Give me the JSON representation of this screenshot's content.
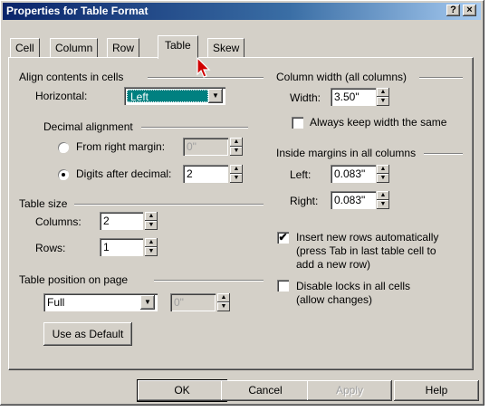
{
  "window": {
    "title": "Properties for Table Format",
    "help_btn": "?",
    "close_btn": "×"
  },
  "tabs": [
    {
      "label": "Cell"
    },
    {
      "label": "Column"
    },
    {
      "label": "Row"
    },
    {
      "label": "Table",
      "active": true
    },
    {
      "label": "Skew"
    }
  ],
  "align": {
    "group_label": "Align contents in cells",
    "horizontal_label": "Horizontal:",
    "horizontal_value": "Left",
    "decimal_group_label": "Decimal alignment",
    "from_right_label": "From right margin:",
    "from_right_value": "0\"",
    "digits_label": "Digits after decimal:",
    "digits_value": "2"
  },
  "table_size": {
    "group_label": "Table size",
    "columns_label": "Columns:",
    "columns_value": "2",
    "rows_label": "Rows:",
    "rows_value": "1"
  },
  "table_position": {
    "group_label": "Table position on page",
    "position_value": "Full",
    "offset_value": "0\""
  },
  "use_default_btn": "Use as Default",
  "column_width": {
    "group_label": "Column width (all columns)",
    "width_label": "Width:",
    "width_value": "3.50\"",
    "keep_same_label": "Always keep width the same"
  },
  "inside_margins": {
    "group_label": "Inside margins in all columns",
    "left_label": "Left:",
    "left_value": "0.083\"",
    "right_label": "Right:",
    "right_value": "0.083\""
  },
  "options": {
    "insert_rows_line1": "Insert new rows automatically",
    "insert_rows_line2": "(press Tab in last table cell to",
    "insert_rows_line3": "add a new row)",
    "disable_locks_line1": "Disable locks in all cells",
    "disable_locks_line2": "(allow changes)"
  },
  "footer": {
    "ok": "OK",
    "cancel": "Cancel",
    "apply": "Apply",
    "help": "Help"
  },
  "colors": {
    "title_start": "#0a246a",
    "selection": "#008080",
    "face": "#d4d0c8"
  }
}
